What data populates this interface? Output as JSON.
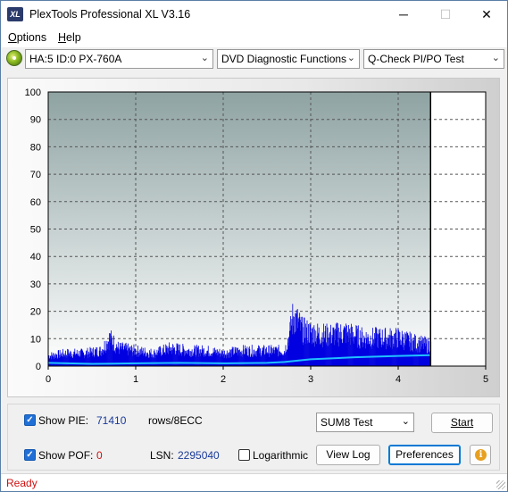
{
  "window": {
    "title": "PlexTools Professional XL V3.16",
    "icon_text": "XL",
    "minimize_glyph": "─",
    "maximize_glyph": "☐",
    "close_glyph": "✕"
  },
  "menu": {
    "items": [
      {
        "label": "Options",
        "accel": "O",
        "rest": "ptions"
      },
      {
        "label": "Help",
        "accel": "H",
        "rest": "elp"
      }
    ]
  },
  "toolbar": {
    "drive": "HA:5 ID:0  PX-760A",
    "function": "DVD Diagnostic Functions",
    "test": "Q-Check PI/PO Test"
  },
  "chart_data": {
    "type": "bar",
    "y_ticks": [
      "100",
      "90",
      "80",
      "70",
      "60",
      "50",
      "40",
      "30",
      "20",
      "10",
      "0"
    ],
    "x_ticks": [
      "0",
      "1",
      "2",
      "3",
      "4",
      "5"
    ],
    "ylim": [
      0,
      100
    ],
    "xlim": [
      0,
      5
    ],
    "data_end_x": 4.37,
    "grid": true,
    "series": [
      {
        "type": "bar",
        "color": "#0000e0",
        "x": [
          0.0,
          0.2,
          0.4,
          0.6,
          0.7,
          0.8,
          1.0,
          1.2,
          1.4,
          1.6,
          1.8,
          2.0,
          2.2,
          2.4,
          2.6,
          2.7,
          2.75,
          2.8,
          2.9,
          3.0,
          3.2,
          3.4,
          3.6,
          3.8,
          4.0,
          4.2,
          4.37
        ],
        "values": [
          4,
          5,
          5,
          6,
          11,
          7,
          6,
          5,
          7,
          6,
          6,
          5,
          6,
          6,
          6,
          6,
          12,
          20,
          14,
          13,
          12,
          13,
          11,
          11,
          11,
          9,
          8
        ]
      },
      {
        "type": "line",
        "color": "#20c0ff",
        "x": [
          0.0,
          0.5,
          1.0,
          1.5,
          2.0,
          2.5,
          2.7,
          3.0,
          3.5,
          4.0,
          4.37
        ],
        "values": [
          1.2,
          0.8,
          1.0,
          1.2,
          1.0,
          1.2,
          1.5,
          2.5,
          3.2,
          3.7,
          4.0
        ]
      }
    ]
  },
  "bottom": {
    "show_pie_label": "Show PIE:",
    "show_pie_value": "71410",
    "rows_label": "rows/8ECC",
    "show_pof_label": "Show POF:",
    "show_pof_value": "0",
    "lsn_label": "LSN:",
    "lsn_value": "2295040",
    "logarithmic_label": "Logarithmic",
    "test_select": "SUM8 Test",
    "start_label": "Start",
    "view_log_label": "View Log",
    "preferences_label": "Preferences",
    "info_glyph": "i"
  },
  "status": {
    "text": "Ready"
  }
}
